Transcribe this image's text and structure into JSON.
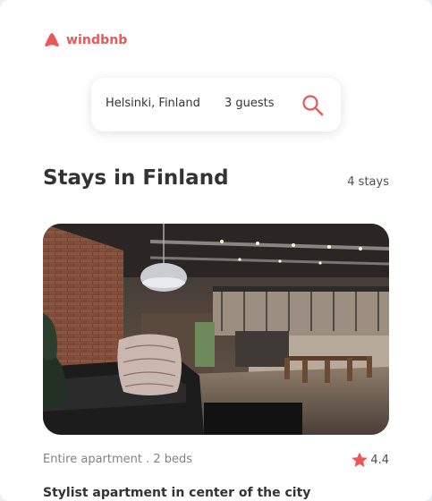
{
  "brand": {
    "name": "windbnb",
    "icon": "windbnb-logo-icon"
  },
  "search": {
    "location": "Helsinki, Finland",
    "guests": "3 guests",
    "icon": "search-icon"
  },
  "listing_header": {
    "title": "Stays in Finland",
    "count": "4 stays"
  },
  "stays": [
    {
      "type_beds": "Entire apartment . 2 beds",
      "rating": "4.4",
      "title": "Stylist apartment in center of the city",
      "image": "loft-apartment-photo"
    }
  ],
  "colors": {
    "brand": "#eb5757",
    "text": "#333333",
    "muted": "#828282"
  }
}
